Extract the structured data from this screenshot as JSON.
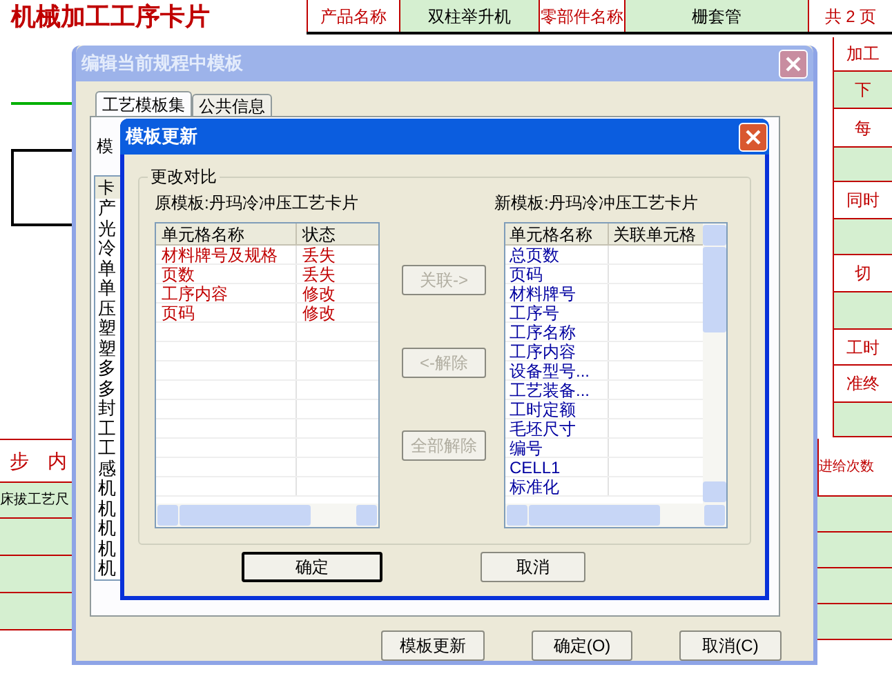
{
  "sheet": {
    "title": "机械加工工序卡片",
    "header_cells": [
      {
        "text": "产品名称",
        "kind": "label"
      },
      {
        "text": "双柱举升机",
        "kind": "value"
      },
      {
        "text": "零部件名称",
        "kind": "label"
      },
      {
        "text": "栅套管",
        "kind": "value"
      },
      {
        "text": "共 2 页",
        "kind": "label"
      }
    ],
    "side_cells": [
      {
        "text": "加工",
        "kind": "label"
      },
      {
        "text": "下",
        "kind": "value"
      },
      {
        "text": "每",
        "kind": "label"
      },
      {
        "text": "",
        "kind": "value"
      },
      {
        "text": "同时",
        "kind": "label"
      },
      {
        "text": "",
        "kind": "value"
      },
      {
        "text": "切",
        "kind": "label"
      },
      {
        "text": "",
        "kind": "value"
      },
      {
        "text": "工时",
        "kind": "label"
      },
      {
        "text": "准终",
        "kind": "label"
      },
      {
        "text": "",
        "kind": "value"
      }
    ],
    "left_heading": [
      "步",
      "内"
    ],
    "left_value": "床拔工艺尺",
    "feed_label": "进给次数"
  },
  "outer_dialog": {
    "title": "编辑当前规程中模板",
    "tabs": [
      {
        "label": "工艺模板集",
        "selected": true
      },
      {
        "label": "公共信息",
        "selected": false
      }
    ],
    "field_label": "模",
    "list_header": "卡",
    "list_items": [
      "产",
      "光",
      "冷",
      "单",
      "单",
      "压",
      "塑",
      "塑",
      "多",
      "多",
      "封",
      "工",
      "工",
      "感",
      "机",
      "机",
      "机",
      "机",
      "机"
    ],
    "buttons": [
      "模板更新",
      "确定(O)",
      "取消(C)"
    ]
  },
  "update_dialog": {
    "title": "模板更新",
    "group_label": "更改对比",
    "old_label": "原模板:丹玛冷冲压工艺卡片",
    "old_columns": [
      "单元格名称",
      "状态"
    ],
    "old_rows": [
      {
        "name": "材料牌号及规格",
        "status": "丢失"
      },
      {
        "name": "页数",
        "status": "丢失"
      },
      {
        "name": "工序内容",
        "status": "修改"
      },
      {
        "name": "页码",
        "status": "修改"
      }
    ],
    "actions": [
      {
        "label": "关联->",
        "disabled": true
      },
      {
        "label": "<-解除",
        "disabled": true
      },
      {
        "label": "全部解除",
        "disabled": true
      }
    ],
    "new_label": "新模板:丹玛冷冲压工艺卡片",
    "new_columns": [
      "单元格名称",
      "关联单元格"
    ],
    "new_rows": [
      "总页数",
      "页码",
      "材料牌号",
      "工序号",
      "工序名称",
      "工序内容",
      "设备型号...",
      "工艺装备...",
      "工时定额",
      "毛坯尺寸",
      "编号",
      "CELL1",
      "标准化"
    ],
    "buttons": [
      {
        "label": "确定",
        "default": true
      },
      {
        "label": "取消",
        "default": false
      }
    ]
  }
}
